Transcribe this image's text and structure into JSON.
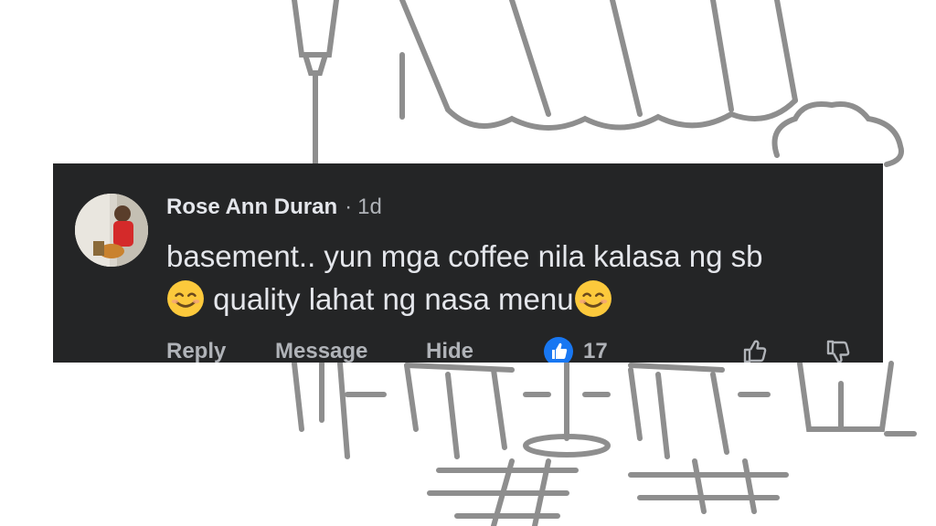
{
  "comment": {
    "author": "Rose Ann Duran",
    "separator": "·",
    "time": "1d",
    "text_part1": "basement.. yun mga coffee nila kalasa ng sb",
    "text_part2": " quality lahat ng nasa menu",
    "emoji": "smiling-face-icon"
  },
  "actions": {
    "reply": "Reply",
    "message": "Message",
    "hide": "Hide",
    "like_count": "17"
  },
  "colors": {
    "card": "#242526",
    "text": "#e4e6eb",
    "secondary": "#b0b3b8",
    "like_blue": "#1877f2",
    "emoji_yellow": "#fcc93c"
  }
}
